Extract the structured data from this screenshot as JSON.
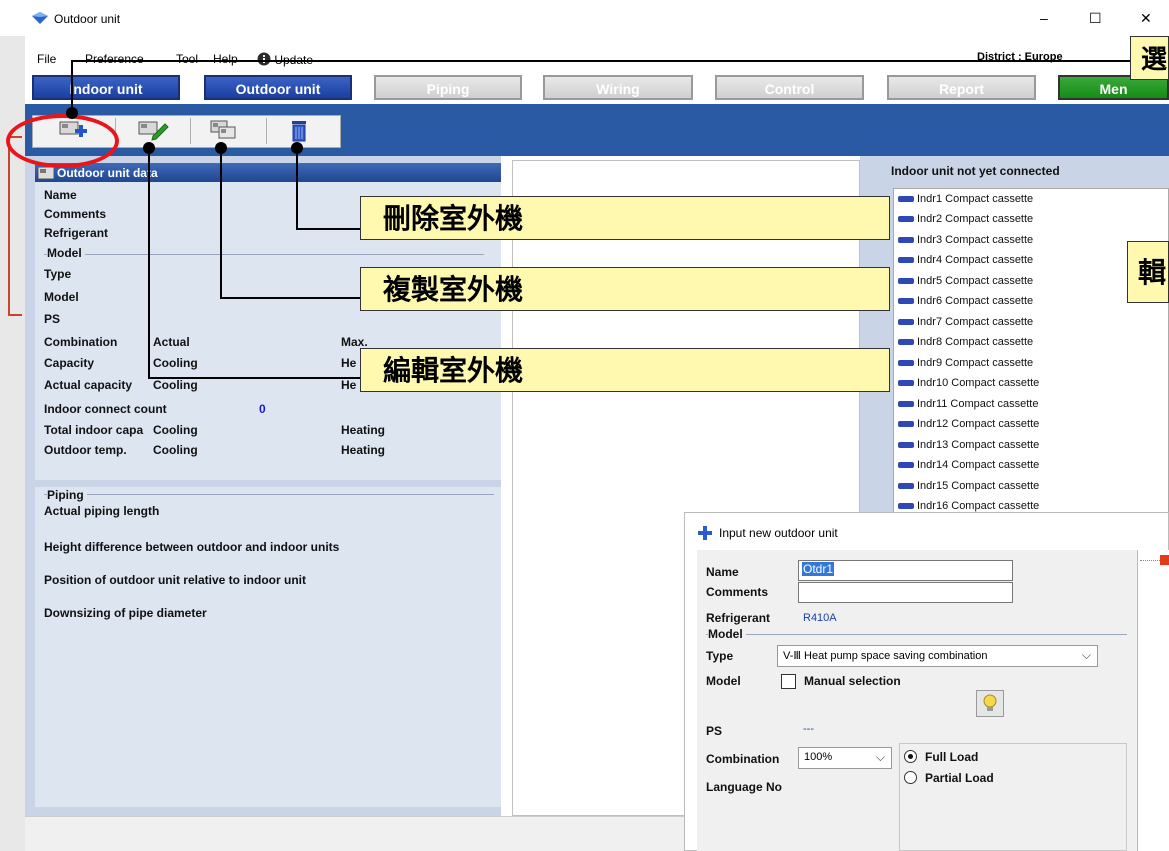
{
  "window": {
    "title": "Outdoor unit",
    "minimize": "–",
    "maximize": "☐",
    "close": "✕"
  },
  "menu": {
    "items": [
      "File",
      "Preference",
      "Tool",
      "Help",
      "Update"
    ],
    "district": "District : Europe"
  },
  "nav_tabs": [
    {
      "label": "Indoor unit",
      "state": "active"
    },
    {
      "label": "Outdoor unit",
      "state": "active"
    },
    {
      "label": "Piping",
      "state": "inactive"
    },
    {
      "label": "Wiring",
      "state": "inactive"
    },
    {
      "label": "Control",
      "state": "inactive"
    },
    {
      "label": "Report",
      "state": "inactive"
    },
    {
      "label": "Men",
      "state": "green"
    }
  ],
  "toolbar": {
    "buttons": [
      "add-outdoor-unit-icon",
      "edit-outdoor-unit-icon",
      "copy-outdoor-unit-icon",
      "delete-outdoor-unit-icon"
    ]
  },
  "outdoor_data": {
    "header": "Outdoor unit data",
    "name": "Name",
    "comments": "Comments",
    "refrigerant": "Refrigerant",
    "model_group": "Model",
    "type": "Type",
    "model": "Model",
    "ps": "PS",
    "combination": "Combination",
    "combination_actual": "Actual",
    "combination_max": "Max.",
    "capacity": "Capacity",
    "capacity_cooling": "Cooling",
    "capacity_heating": "He",
    "actual_capacity": "Actual capacity",
    "actual_capacity_cooling": "Cooling",
    "actual_capacity_heating": "He",
    "indoor_connect_count": "Indoor connect count",
    "indoor_connect_count_value": "0",
    "total_indoor_capa": "Total indoor capa",
    "total_indoor_capa_cooling": "Cooling",
    "total_indoor_capa_heating": "Heating",
    "outdoor_temp": "Outdoor temp.",
    "outdoor_temp_cooling": "Cooling",
    "outdoor_temp_heating": "Heating"
  },
  "piping": {
    "group": "Piping",
    "actual_length": "Actual piping length",
    "height_diff": "Height difference between outdoor and indoor units",
    "position": "Position of outdoor unit relative to indoor unit",
    "downsizing": "Downsizing of pipe diameter"
  },
  "indoor_list": {
    "header": "Indoor unit not yet connected",
    "items": [
      "Indr1  Compact cassette",
      "Indr2  Compact cassette",
      "Indr3  Compact cassette",
      "Indr4  Compact cassette",
      "Indr5  Compact cassette",
      "Indr6  Compact cassette",
      "Indr7  Compact cassette",
      "Indr8  Compact cassette",
      "Indr9  Compact cassette",
      "Indr10  Compact cassette",
      "Indr11  Compact cassette",
      "Indr12  Compact cassette",
      "Indr13  Compact cassette",
      "Indr14  Compact cassette",
      "Indr15  Compact cassette",
      "Indr16  Compact cassette"
    ]
  },
  "callouts": {
    "delete": "刪除室外機",
    "copy": "複製室外機",
    "edit": "編輯室外機",
    "top_right": "選",
    "side_right": "輯"
  },
  "dialog": {
    "title": "Input new outdoor unit",
    "name_label": "Name",
    "name_value": "Otdr1",
    "comments_label": "Comments",
    "comments_value": "",
    "refrigerant_label": "Refrigerant",
    "refrigerant_value": "R410A",
    "model_group": "Model",
    "type_label": "Type",
    "type_value": "V-Ⅲ Heat pump space saving combination",
    "model_label": "Model",
    "manual_selection": "Manual selection",
    "ps_label": "PS",
    "ps_value": "---",
    "combination_label": "Combination",
    "combination_value": "100%",
    "full_load": "Full Load",
    "partial_load": "Partial Load",
    "language_no": "Language No"
  },
  "colors": {
    "toolbar_blue": "#2b5aa4",
    "panel_blue": "#c9d4e6",
    "callout_yellow": "#fff9b0",
    "highlight_red": "#e8161b"
  }
}
